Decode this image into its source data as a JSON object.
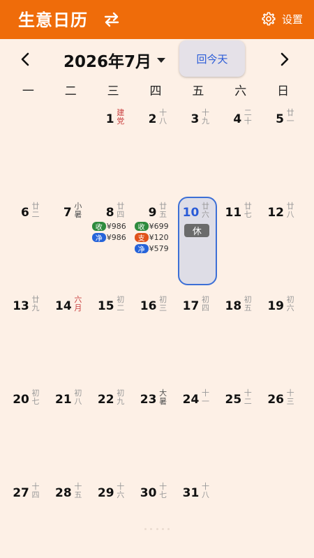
{
  "header": {
    "title": "生意日历",
    "settings_label": "设置"
  },
  "month_nav": {
    "title": "2026年7月",
    "today_label": "回今天"
  },
  "weekdays": [
    "一",
    "二",
    "三",
    "四",
    "五",
    "六",
    "日"
  ],
  "weeks": [
    [
      null,
      null,
      {
        "day": "1",
        "lunar": "建党",
        "lunar_style": "red"
      },
      {
        "day": "2",
        "lunar": "十八"
      },
      {
        "day": "3",
        "lunar": "十九"
      },
      {
        "day": "4",
        "lunar": "二十"
      },
      {
        "day": "5",
        "lunar": "廿一"
      }
    ],
    [
      {
        "day": "6",
        "lunar": "廿二"
      },
      {
        "day": "7",
        "lunar": "小暑",
        "lunar_style": "jq"
      },
      {
        "day": "8",
        "lunar": "廿四",
        "entries": [
          {
            "tag": "收",
            "type": "income",
            "amount": "¥986"
          },
          {
            "tag": "净",
            "type": "net",
            "amount": "¥986"
          }
        ]
      },
      {
        "day": "9",
        "lunar": "廿五",
        "entries": [
          {
            "tag": "收",
            "type": "income",
            "amount": "¥699"
          },
          {
            "tag": "支",
            "type": "expense",
            "amount": "¥120"
          },
          {
            "tag": "净",
            "type": "net",
            "amount": "¥579"
          }
        ]
      },
      {
        "day": "10",
        "lunar": "廿六",
        "today": true,
        "badge": "休"
      },
      {
        "day": "11",
        "lunar": "廿七"
      },
      {
        "day": "12",
        "lunar": "廿八"
      }
    ],
    [
      {
        "day": "13",
        "lunar": "廿九"
      },
      {
        "day": "14",
        "lunar": "六月",
        "lunar_style": "red"
      },
      {
        "day": "15",
        "lunar": "初二"
      },
      {
        "day": "16",
        "lunar": "初三"
      },
      {
        "day": "17",
        "lunar": "初四"
      },
      {
        "day": "18",
        "lunar": "初五"
      },
      {
        "day": "19",
        "lunar": "初六"
      }
    ],
    [
      {
        "day": "20",
        "lunar": "初七"
      },
      {
        "day": "21",
        "lunar": "初八"
      },
      {
        "day": "22",
        "lunar": "初九"
      },
      {
        "day": "23",
        "lunar": "大暑",
        "lunar_style": "jq"
      },
      {
        "day": "24",
        "lunar": "十一"
      },
      {
        "day": "25",
        "lunar": "十二"
      },
      {
        "day": "26",
        "lunar": "十三"
      }
    ],
    [
      {
        "day": "27",
        "lunar": "十四"
      },
      {
        "day": "28",
        "lunar": "十五"
      },
      {
        "day": "29",
        "lunar": "十六"
      },
      {
        "day": "30",
        "lunar": "十七"
      },
      {
        "day": "31",
        "lunar": "十八"
      },
      null,
      null
    ]
  ],
  "colors": {
    "toolbar": "#ef6c0a",
    "background": "#fdf0e6",
    "accent_blue": "#2a5bd7",
    "income": "#2e8b3e",
    "expense": "#e0521a",
    "net": "#2563d9"
  },
  "icons": {
    "swap": "swap-arrows-icon",
    "settings": "gear-icon",
    "prev": "chevron-left-icon",
    "next": "chevron-right-icon",
    "dropdown": "caret-down-icon"
  }
}
